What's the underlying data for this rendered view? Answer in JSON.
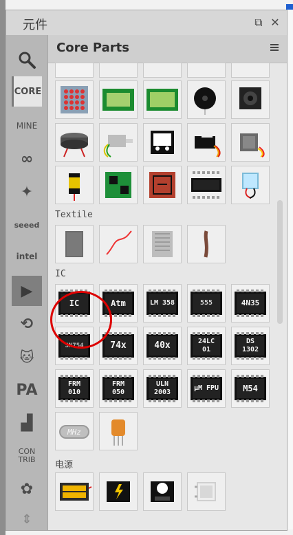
{
  "panel": {
    "title": "元件",
    "buttons": {
      "dock": "⧉",
      "close": "✕"
    }
  },
  "sidebar": {
    "items": [
      {
        "name": "search-button",
        "label": "🔍"
      },
      {
        "name": "core-tab",
        "label": "CORE"
      },
      {
        "name": "mine-tab",
        "label": "MINE"
      },
      {
        "name": "arduino-bin",
        "label": "∞"
      },
      {
        "name": "sparkfun-bin",
        "label": "✦"
      },
      {
        "name": "seeed-bin",
        "label": "seeed"
      },
      {
        "name": "intel-bin",
        "label": "intel"
      },
      {
        "name": "play-bin",
        "label": "▶"
      },
      {
        "name": "circuit-bin",
        "label": "⟲"
      },
      {
        "name": "cat-bin",
        "label": "🐱"
      },
      {
        "name": "pa-bin",
        "label": "PA"
      },
      {
        "name": "chip-bin",
        "label": "▟"
      },
      {
        "name": "contrib-tab",
        "label": "CON TRIB"
      },
      {
        "name": "flower-bin",
        "label": "✿"
      }
    ]
  },
  "main": {
    "title": "Core Parts",
    "sections": {
      "textile": "Textile",
      "ic": "IC",
      "power": "电源"
    },
    "ic_labels": {
      "r1": [
        "IC",
        "Atm",
        "LM 358",
        "555",
        "4N35"
      ],
      "r2": [
        "SN754",
        "74x",
        "40x",
        "24LC 01",
        "DS 1302"
      ],
      "r3": [
        "FRM 010",
        "FRM 050",
        "ULN 2003",
        "μM FPU",
        "M54"
      ],
      "r4": [
        "MHz",
        ""
      ]
    }
  },
  "colors": {
    "accent": "#1f5fd0",
    "highlight_circle": "#dd0000"
  }
}
